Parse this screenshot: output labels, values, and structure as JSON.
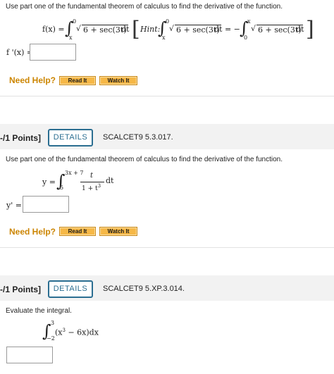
{
  "q1": {
    "instruction": "Use part one of the fundamental theorem of calculus to find the derivative of the function.",
    "fx": "f(x) =",
    "int_upper": "0",
    "int_lower": "x",
    "radicand": "6 + sec(3t)",
    "dt": "dt",
    "hint_label": "Hint:",
    "hint_eq": "dt = −",
    "hint_int2_upper": "x",
    "hint_int2_lower": "0",
    "answer_label": "f '(x) ="
  },
  "help1": {
    "need_help": "Need Help?",
    "read_it": "Read It",
    "watch_it": "Watch It"
  },
  "q2": {
    "points": "-/1 Points]",
    "details": "DETAILS",
    "code": "SCALCET9 5.3.017.",
    "instruction": "Use part one of the fundamental theorem of calculus to find the derivative of the function.",
    "y_eq": "y =",
    "int_upper": "3x + 7",
    "int_lower": "5",
    "numerator": "t",
    "denominator_base": "1 + t",
    "denominator_exp": "3",
    "dt": "dt",
    "answer_label": "y' ="
  },
  "help2": {
    "need_help": "Need Help?",
    "read_it": "Read It",
    "watch_it": "Watch It"
  },
  "q3": {
    "points": "-/1 Points]",
    "details": "DETAILS",
    "code": "SCALCET9 5.XP.3.014.",
    "instruction": "Evaluate the integral.",
    "int_upper": "3",
    "int_lower": "−2",
    "integrand_a": "(x",
    "integrand_exp": "3",
    "integrand_b": " − 6x)dx"
  }
}
